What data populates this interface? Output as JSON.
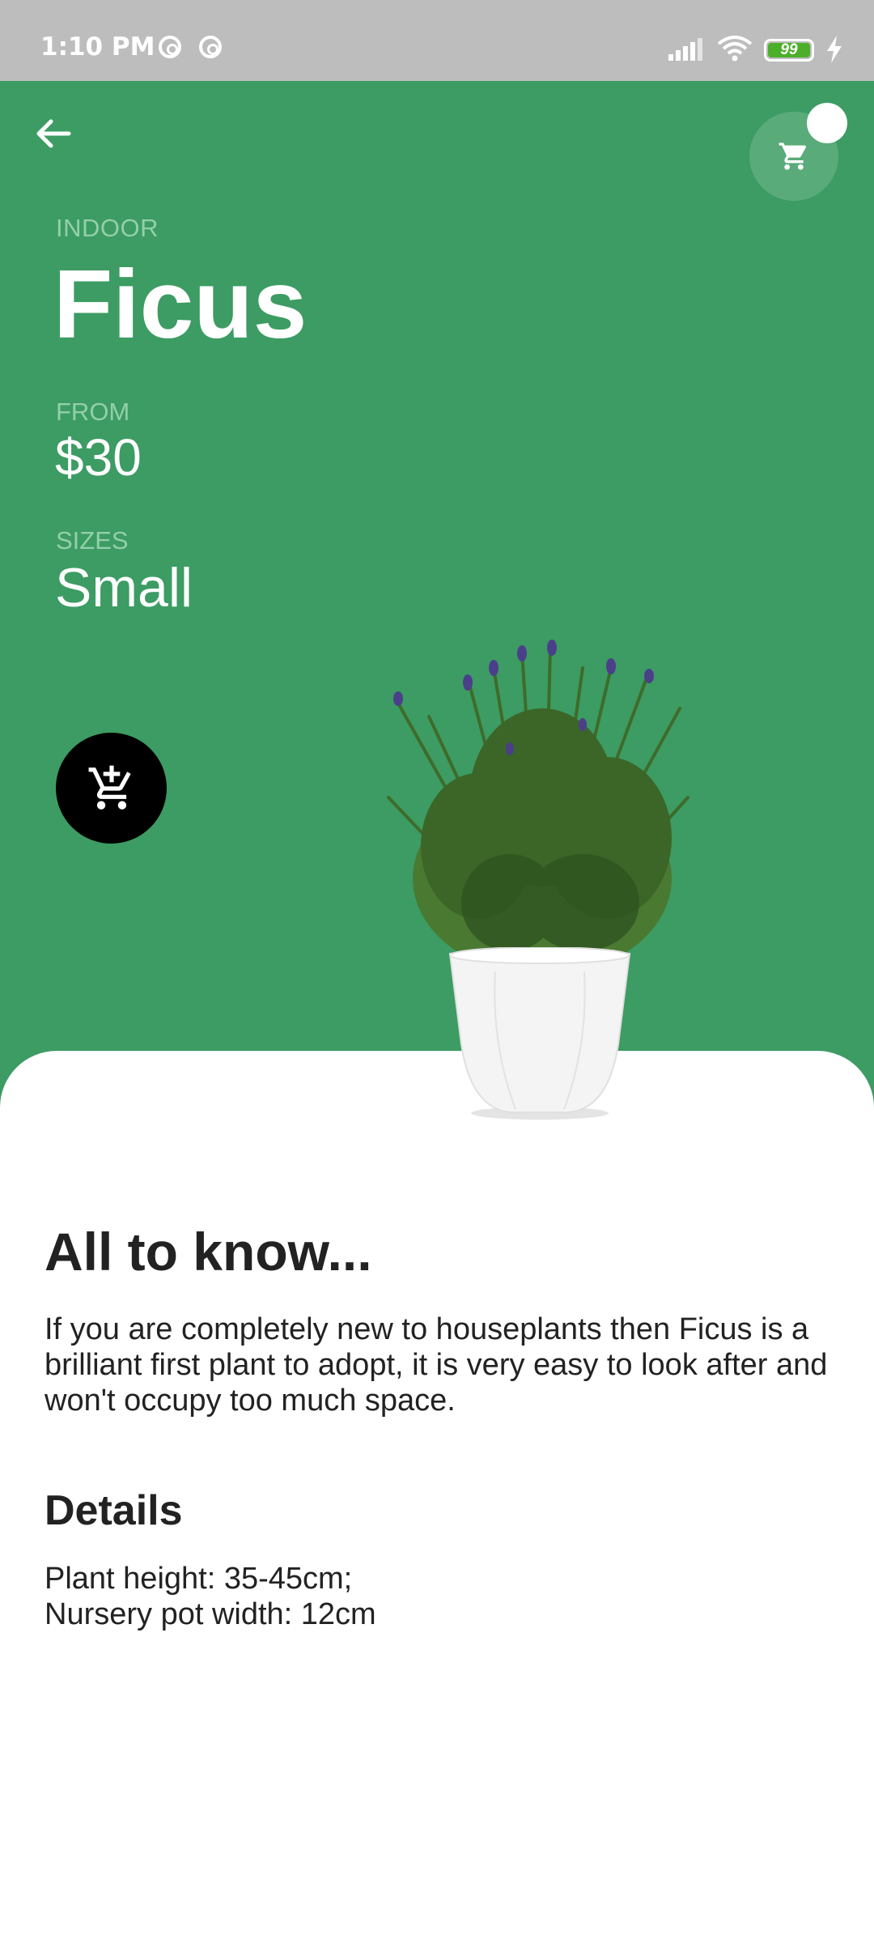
{
  "status_bar": {
    "time": "1:10 PM",
    "battery": "99",
    "icons": [
      "at-icon",
      "at-icon",
      "signal-icon",
      "wifi-icon",
      "battery-icon",
      "charging-icon"
    ]
  },
  "header": {
    "category": "INDOOR",
    "name": "Ficus",
    "from_label": "FROM",
    "price": "$30",
    "sizes_label": "SIZES",
    "size": "Small"
  },
  "content": {
    "title": "All to know...",
    "description": "If you are completely new to houseplants then Ficus is a brilliant first plant to adopt, it is very easy to look after and won't occupy too much space.",
    "details_title": "Details",
    "details": [
      "Plant height: 35-45cm;",
      "Nursery pot width: 12cm"
    ]
  },
  "colors": {
    "header_green": "#3c9c63",
    "label_green": "#93cfa9",
    "fab_black": "#000000",
    "text_dark": "#222222"
  }
}
